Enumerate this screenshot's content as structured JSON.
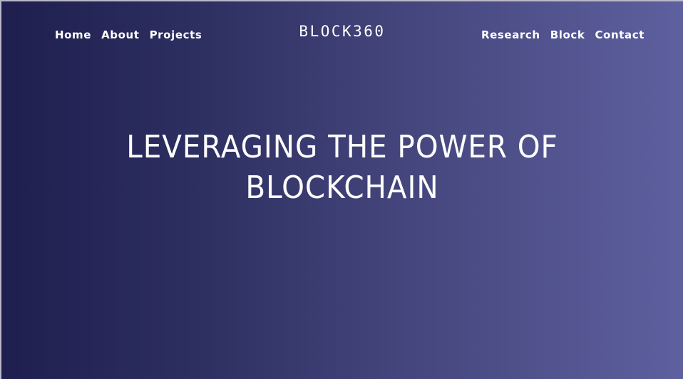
{
  "nav": {
    "left_items": [
      {
        "label": "Home"
      },
      {
        "label": "About"
      },
      {
        "label": "Projects"
      }
    ],
    "right_items": [
      {
        "label": "Research"
      },
      {
        "label": "Block"
      },
      {
        "label": "Contact"
      }
    ]
  },
  "brand": {
    "logo_text": "BLOCK360"
  },
  "hero": {
    "heading_line1": "LEVERAGING THE POWER OF",
    "heading_line2": "BLOCKCHAIN"
  },
  "colors": {
    "gradient_start": "#1e1f4e",
    "gradient_end": "#5e609f",
    "text": "#ffffff"
  }
}
